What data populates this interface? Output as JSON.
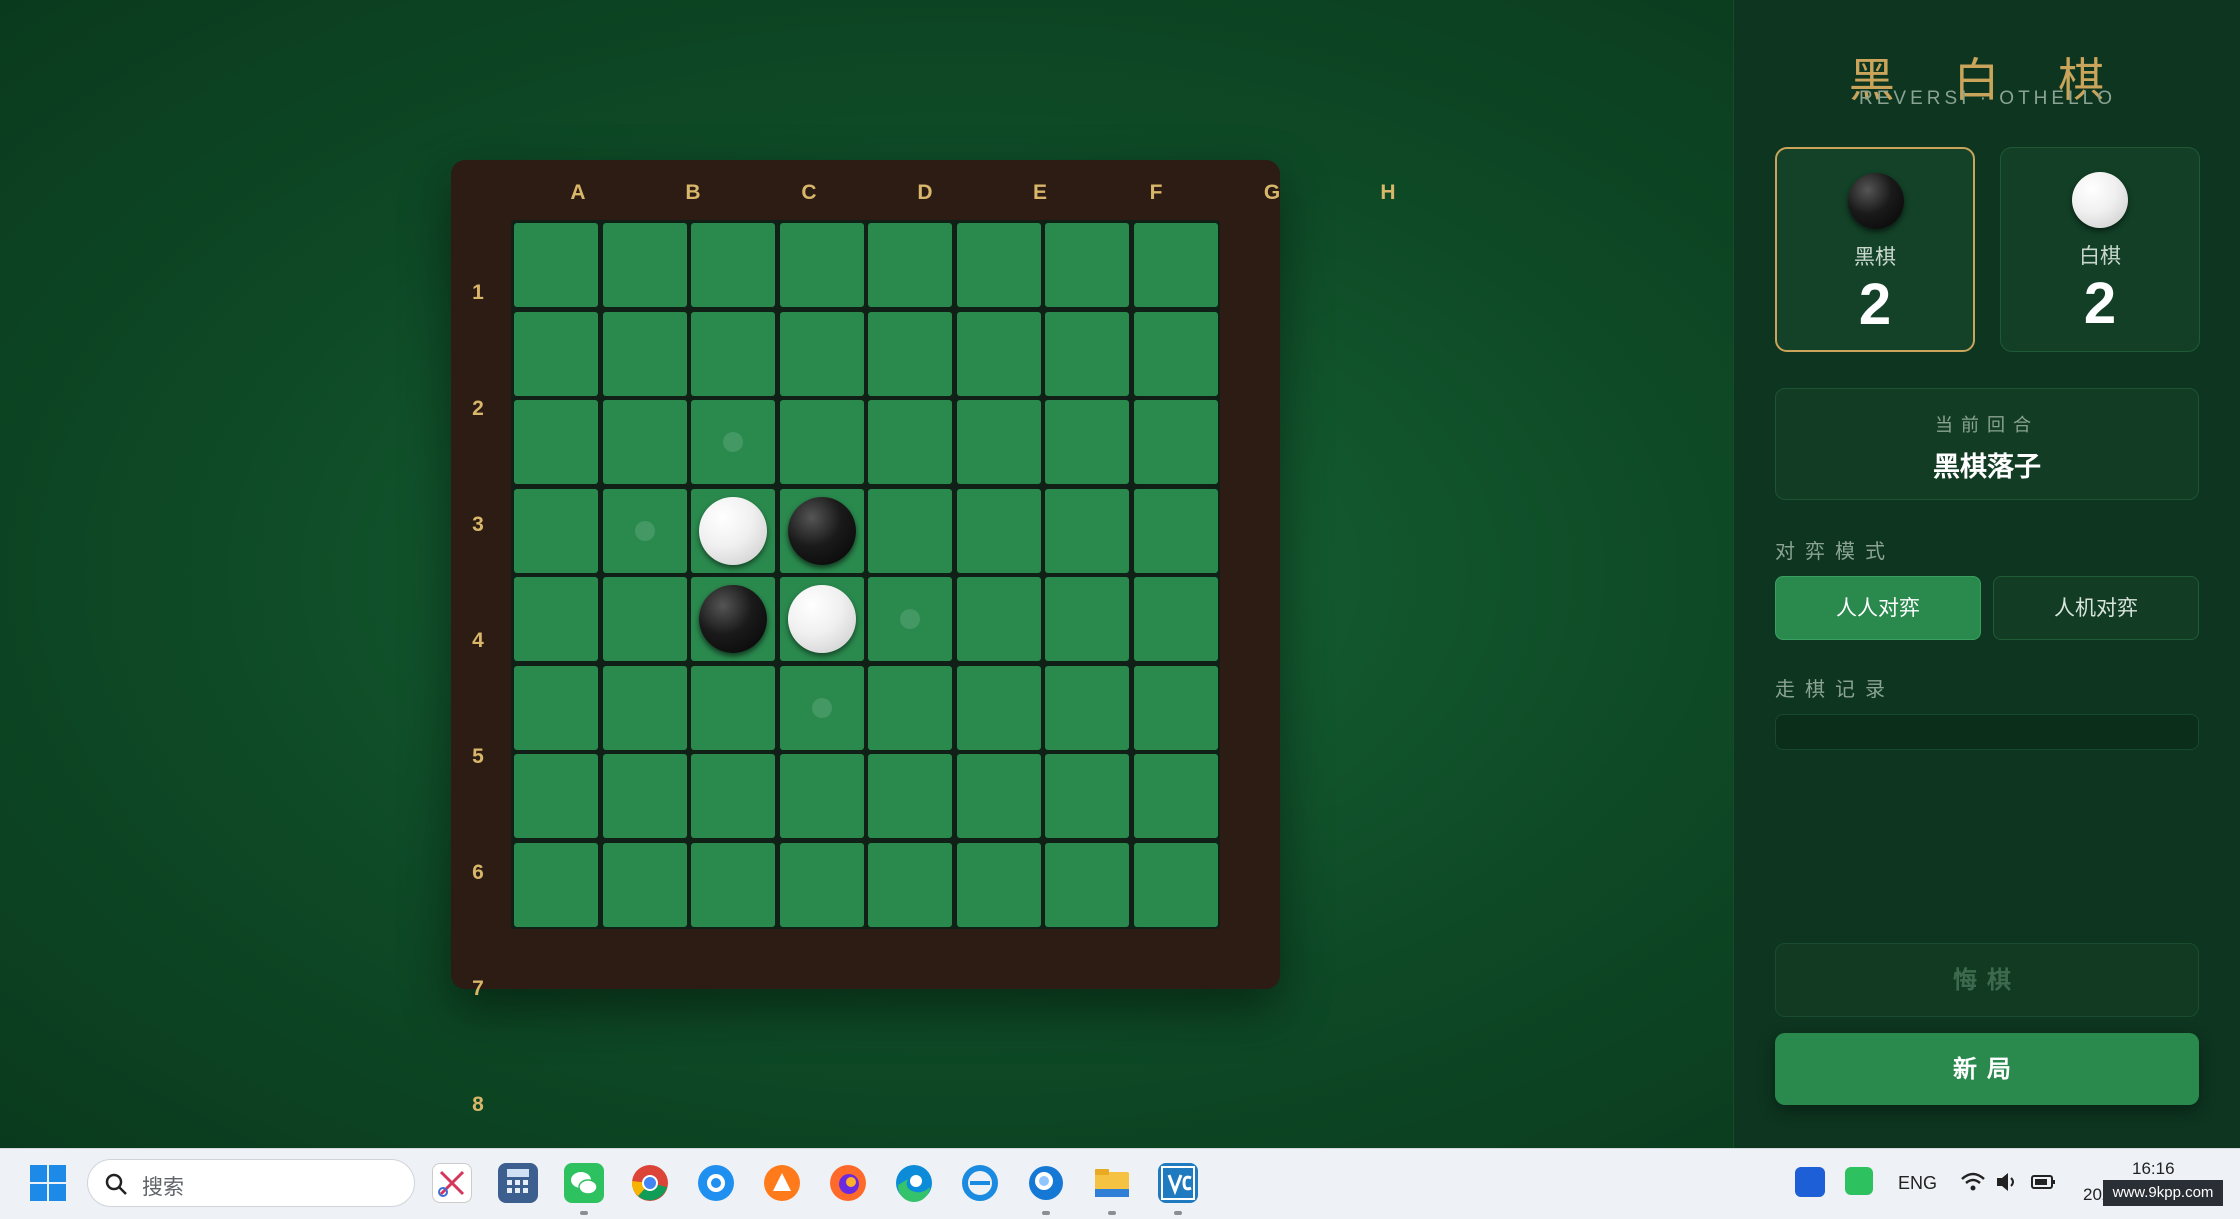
{
  "board": {
    "columns": [
      "A",
      "B",
      "C",
      "D",
      "E",
      "F",
      "G",
      "H"
    ],
    "rows": [
      "1",
      "2",
      "3",
      "4",
      "5",
      "6",
      "7",
      "8"
    ],
    "stones": [
      {
        "col": 3,
        "row": 4,
        "color": "white"
      },
      {
        "col": 4,
        "row": 4,
        "color": "black"
      },
      {
        "col": 3,
        "row": 5,
        "color": "black"
      },
      {
        "col": 4,
        "row": 5,
        "color": "white"
      }
    ],
    "hints": [
      {
        "col": 3,
        "row": 3
      },
      {
        "col": 2,
        "row": 4
      },
      {
        "col": 5,
        "row": 5
      },
      {
        "col": 4,
        "row": 6
      }
    ]
  },
  "panel": {
    "title": "黑 白 棋",
    "subtitle": "REVERSI · OTHELLO",
    "black": {
      "label": "黑棋",
      "score": "2"
    },
    "white": {
      "label": "白棋",
      "score": "2"
    },
    "turn_label": "当前回合",
    "turn_value": "黑棋落子",
    "mode_label": "对弈模式",
    "mode_pvp": "人人对弈",
    "mode_pve": "人机对弈",
    "history_label": "走棋记录",
    "undo": "悔棋",
    "new_game": "新局"
  },
  "colors": {
    "board_green": "#2a8a4e",
    "frame_brown": "#2c1c14",
    "gold": "#c9a45a"
  },
  "taskbar": {
    "search_placeholder": "搜索",
    "language": "ENG",
    "time": "16:16",
    "date_partial": "202",
    "watermark": "www.9kpp.com",
    "apps": [
      "start-icon",
      "snipping-tool-icon",
      "calculator-icon",
      "wechat-icon",
      "chrome-icon",
      "browser-icon",
      "app-icon",
      "firefox-icon",
      "edge-icon",
      "ie-icon",
      "app-search-icon",
      "file-explorer-icon",
      "vscode-icon"
    ]
  }
}
